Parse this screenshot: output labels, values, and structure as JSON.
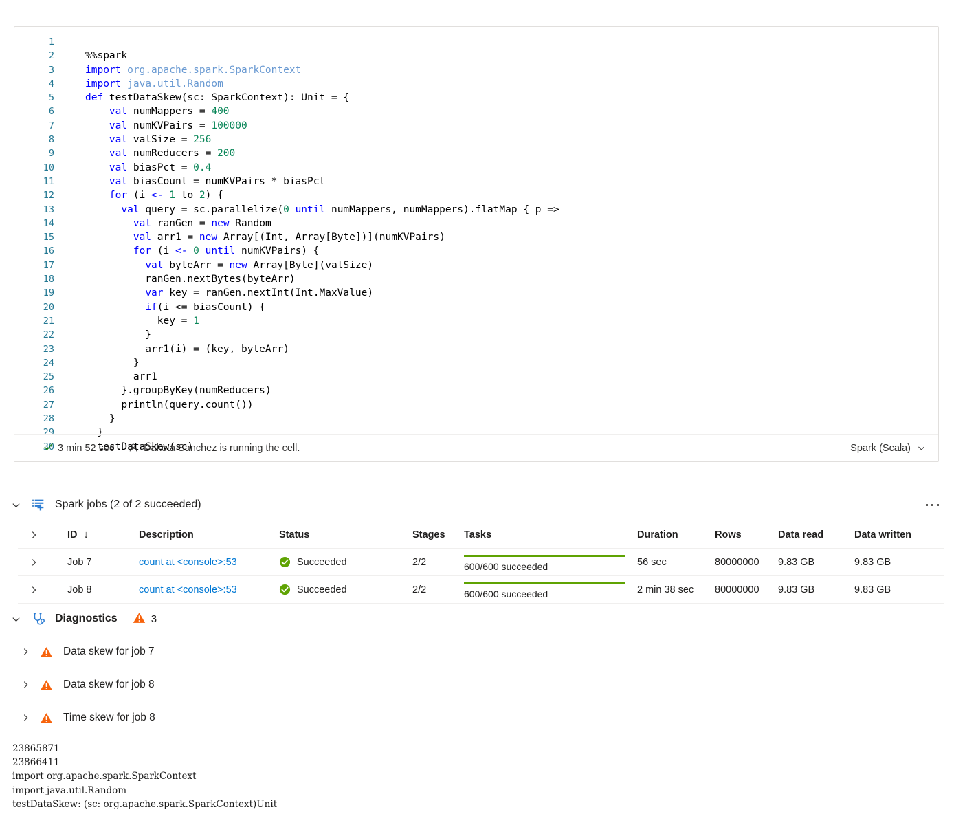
{
  "cell": {
    "language": "Spark (Scala)",
    "status": {
      "duration": "3 min 52 sec -",
      "message": "Dakota Sanchez is running the cell.",
      "check_icon": "checkmark-icon",
      "person_icon": "person-icon"
    },
    "code_lines": [
      {
        "n": "1",
        "tokens": []
      },
      {
        "n": "2",
        "tokens": [
          {
            "t": "%%spark",
            "c": "plain"
          }
        ]
      },
      {
        "n": "3",
        "tokens": [
          {
            "t": "import",
            "c": "kw"
          },
          {
            "t": " ",
            "c": "plain"
          },
          {
            "t": "org.apache.spark.SparkContext",
            "c": "pkg"
          }
        ]
      },
      {
        "n": "4",
        "tokens": [
          {
            "t": "import",
            "c": "kw"
          },
          {
            "t": " ",
            "c": "plain"
          },
          {
            "t": "java.util.Random",
            "c": "pkg"
          }
        ]
      },
      {
        "n": "5",
        "tokens": [
          {
            "t": "def",
            "c": "kw"
          },
          {
            "t": " testDataSkew(sc: SparkContext): Unit = {",
            "c": "plain"
          }
        ]
      },
      {
        "n": "6",
        "tokens": [
          {
            "t": "    ",
            "c": "plain"
          },
          {
            "t": "val",
            "c": "kw"
          },
          {
            "t": " numMappers = ",
            "c": "plain"
          },
          {
            "t": "400",
            "c": "num"
          }
        ]
      },
      {
        "n": "7",
        "tokens": [
          {
            "t": "    ",
            "c": "plain"
          },
          {
            "t": "val",
            "c": "kw"
          },
          {
            "t": " numKVPairs = ",
            "c": "plain"
          },
          {
            "t": "100000",
            "c": "num"
          }
        ]
      },
      {
        "n": "8",
        "tokens": [
          {
            "t": "    ",
            "c": "plain"
          },
          {
            "t": "val",
            "c": "kw"
          },
          {
            "t": " valSize = ",
            "c": "plain"
          },
          {
            "t": "256",
            "c": "num"
          }
        ]
      },
      {
        "n": "9",
        "tokens": [
          {
            "t": "    ",
            "c": "plain"
          },
          {
            "t": "val",
            "c": "kw"
          },
          {
            "t": " numReducers = ",
            "c": "plain"
          },
          {
            "t": "200",
            "c": "num"
          }
        ]
      },
      {
        "n": "10",
        "tokens": [
          {
            "t": "    ",
            "c": "plain"
          },
          {
            "t": "val",
            "c": "kw"
          },
          {
            "t": " biasPct = ",
            "c": "plain"
          },
          {
            "t": "0.4",
            "c": "num"
          }
        ]
      },
      {
        "n": "11",
        "tokens": [
          {
            "t": "    ",
            "c": "plain"
          },
          {
            "t": "val",
            "c": "kw"
          },
          {
            "t": " biasCount = numKVPairs * biasPct",
            "c": "plain"
          }
        ]
      },
      {
        "n": "12",
        "tokens": [
          {
            "t": "    ",
            "c": "plain"
          },
          {
            "t": "for",
            "c": "kw"
          },
          {
            "t": " (i ",
            "c": "plain"
          },
          {
            "t": "<-",
            "c": "kw"
          },
          {
            "t": " ",
            "c": "plain"
          },
          {
            "t": "1",
            "c": "num"
          },
          {
            "t": " to ",
            "c": "plain"
          },
          {
            "t": "2",
            "c": "num"
          },
          {
            "t": ") {",
            "c": "plain"
          }
        ]
      },
      {
        "n": "13",
        "tokens": [
          {
            "t": "      ",
            "c": "plain"
          },
          {
            "t": "val",
            "c": "kw"
          },
          {
            "t": " query = sc.parallelize(",
            "c": "plain"
          },
          {
            "t": "0",
            "c": "num"
          },
          {
            "t": " until",
            "c": "kw"
          },
          {
            "t": " numMappers, numMappers).flatMap { p =>",
            "c": "plain"
          }
        ]
      },
      {
        "n": "14",
        "tokens": [
          {
            "t": "        ",
            "c": "plain"
          },
          {
            "t": "val",
            "c": "kw"
          },
          {
            "t": " ranGen = ",
            "c": "plain"
          },
          {
            "t": "new",
            "c": "kw"
          },
          {
            "t": " Random",
            "c": "plain"
          }
        ]
      },
      {
        "n": "15",
        "tokens": [
          {
            "t": "        ",
            "c": "plain"
          },
          {
            "t": "val",
            "c": "kw"
          },
          {
            "t": " arr1 = ",
            "c": "plain"
          },
          {
            "t": "new",
            "c": "kw"
          },
          {
            "t": " Array[(Int, Array[Byte])](numKVPairs)",
            "c": "plain"
          }
        ]
      },
      {
        "n": "16",
        "tokens": [
          {
            "t": "        ",
            "c": "plain"
          },
          {
            "t": "for",
            "c": "kw"
          },
          {
            "t": " (i ",
            "c": "plain"
          },
          {
            "t": "<-",
            "c": "kw"
          },
          {
            "t": " ",
            "c": "plain"
          },
          {
            "t": "0",
            "c": "num"
          },
          {
            "t": " until",
            "c": "kw"
          },
          {
            "t": " numKVPairs) {",
            "c": "plain"
          }
        ]
      },
      {
        "n": "17",
        "tokens": [
          {
            "t": "          ",
            "c": "plain"
          },
          {
            "t": "val",
            "c": "kw"
          },
          {
            "t": " byteArr = ",
            "c": "plain"
          },
          {
            "t": "new",
            "c": "kw"
          },
          {
            "t": " Array[Byte](valSize)",
            "c": "plain"
          }
        ]
      },
      {
        "n": "18",
        "tokens": [
          {
            "t": "          ranGen.nextBytes(byteArr)",
            "c": "plain"
          }
        ]
      },
      {
        "n": "19",
        "tokens": [
          {
            "t": "          ",
            "c": "plain"
          },
          {
            "t": "var",
            "c": "kw"
          },
          {
            "t": " key = ranGen.nextInt(Int.MaxValue)",
            "c": "plain"
          }
        ]
      },
      {
        "n": "20",
        "tokens": [
          {
            "t": "          ",
            "c": "plain"
          },
          {
            "t": "if",
            "c": "kw"
          },
          {
            "t": "(i <= biasCount) {",
            "c": "plain"
          }
        ]
      },
      {
        "n": "21",
        "tokens": [
          {
            "t": "            key = ",
            "c": "plain"
          },
          {
            "t": "1",
            "c": "num"
          }
        ]
      },
      {
        "n": "22",
        "tokens": [
          {
            "t": "          }",
            "c": "plain"
          }
        ]
      },
      {
        "n": "23",
        "tokens": [
          {
            "t": "          arr1(i) = (key, byteArr)",
            "c": "plain"
          }
        ]
      },
      {
        "n": "24",
        "tokens": [
          {
            "t": "        }",
            "c": "plain"
          }
        ]
      },
      {
        "n": "25",
        "tokens": [
          {
            "t": "        arr1",
            "c": "plain"
          }
        ]
      },
      {
        "n": "26",
        "tokens": [
          {
            "t": "      }.groupByKey(numReducers)",
            "c": "plain"
          }
        ]
      },
      {
        "n": "27",
        "tokens": [
          {
            "t": "      println(query.count())",
            "c": "plain"
          }
        ]
      },
      {
        "n": "28",
        "tokens": [
          {
            "t": "    }",
            "c": "plain"
          }
        ]
      },
      {
        "n": "29",
        "tokens": [
          {
            "t": "  }",
            "c": "plain"
          }
        ]
      },
      {
        "n": "30",
        "tokens": [
          {
            "t": "  testDataSkew(sc)",
            "c": "plain"
          }
        ]
      }
    ]
  },
  "spark_jobs": {
    "title": "Spark jobs (2 of 2 succeeded)",
    "icon": "spark-jobs-icon",
    "chevron": "chevron-down-icon",
    "more_icon": "more-options-icon",
    "columns": {
      "id": "ID",
      "sort_arrow": "↓",
      "description": "Description",
      "status": "Status",
      "stages": "Stages",
      "tasks": "Tasks",
      "duration": "Duration",
      "rows": "Rows",
      "data_read": "Data read",
      "data_written": "Data written"
    },
    "rows": [
      {
        "id": "Job 7",
        "description": "count at <console>:53",
        "status": "Succeeded",
        "stages": "2/2",
        "tasks": "600/600 succeeded",
        "tasks_progress": 100,
        "duration": "56 sec",
        "rows": "80000000",
        "data_read": "9.83 GB",
        "data_written": "9.83 GB"
      },
      {
        "id": "Job 8",
        "description": "count at <console>:53",
        "status": "Succeeded",
        "stages": "2/2",
        "tasks": "600/600 succeeded",
        "tasks_progress": 100,
        "duration": "2 min 38 sec",
        "rows": "80000000",
        "data_read": "9.83 GB",
        "data_written": "9.83 GB"
      }
    ]
  },
  "diagnostics": {
    "title": "Diagnostics",
    "icon": "stethoscope-icon",
    "chevron": "chevron-down-icon",
    "warning_count": "3",
    "items": [
      {
        "label": "Data skew for job 7"
      },
      {
        "label": "Data skew for job 8"
      },
      {
        "label": "Time skew for job 8"
      }
    ]
  },
  "output": {
    "lines": [
      "23865871",
      "23866411",
      "import org.apache.spark.SparkContext",
      "import java.util.Random",
      "testDataSkew: (sc: org.apache.spark.SparkContext)Unit"
    ]
  },
  "colors": {
    "accent": "#0078d4",
    "success": "#5fa302",
    "warning": "#f7630c",
    "keyword": "#0000ff",
    "number": "#098658",
    "package": "#6a9ad2",
    "linenum": "#237893"
  }
}
